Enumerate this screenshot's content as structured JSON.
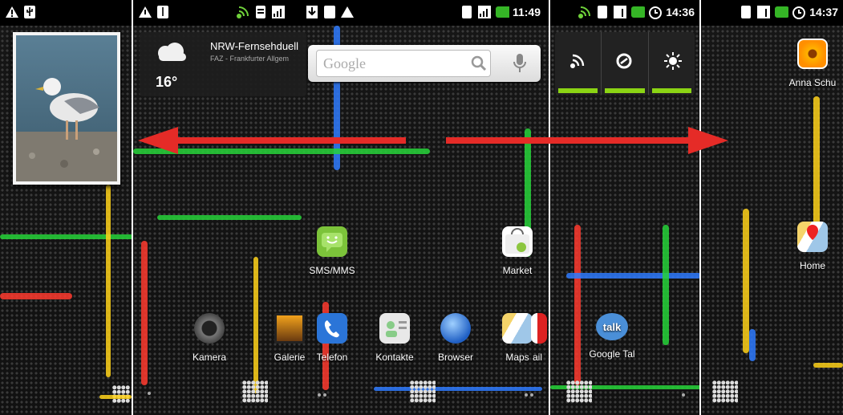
{
  "status": {
    "panel2_time": "11:49",
    "panel3_time": "14:36",
    "panel4_time": "14:37"
  },
  "weather": {
    "headline": "NRW-Fernsehduell",
    "source": "FAZ - Frankfurter Allgem",
    "temperature": "16°"
  },
  "search": {
    "placeholder": "Google"
  },
  "apps": {
    "sms": "SMS/MMS",
    "market": "Market",
    "kamera": "Kamera",
    "galerie": "Galerie",
    "telefon": "Telefon",
    "kontakte": "Kontakte",
    "browser": "Browser",
    "maps": "Maps",
    "gmail_partial": "ail",
    "talk": "Google Tal",
    "anna": "Anna Schu",
    "home": "Home"
  },
  "talk_badge": "talk",
  "colors": {
    "arrow": "#e52b27",
    "power_bar": "#8bd414",
    "streak_red": "#ff3b2f",
    "streak_green": "#27d33a",
    "streak_blue": "#2f7bff",
    "streak_yellow": "#ffd21a"
  }
}
